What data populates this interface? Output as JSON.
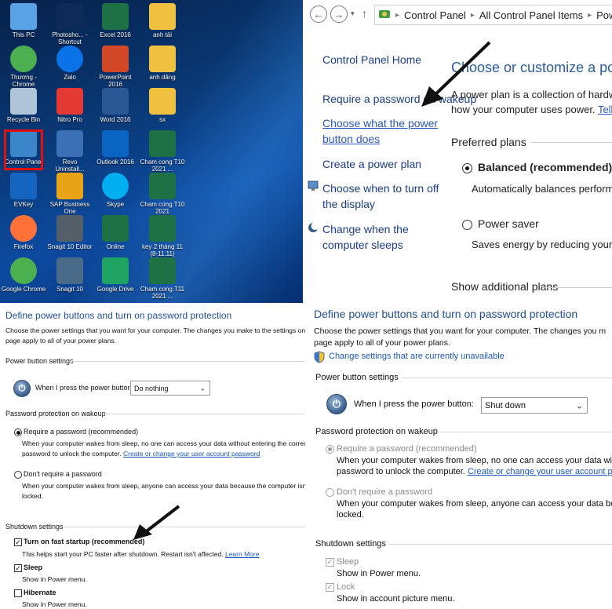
{
  "desktop": {
    "icons": [
      {
        "label": "This PC",
        "icon": "monitor-icon",
        "color": "#5aa2e6"
      },
      {
        "label": "Photosho... - Shortcut",
        "icon": "photoshop-icon",
        "color": "#0d2a58"
      },
      {
        "label": "Excel 2016",
        "icon": "excel-icon",
        "color": "#1e7145"
      },
      {
        "label": "anh tải",
        "icon": "folder-icon",
        "color": "#f0c040"
      },
      {
        "label": "Thương - Chrome",
        "icon": "chrome-icon",
        "color": "#4caf50"
      },
      {
        "label": "Zalo",
        "icon": "zalo-icon",
        "color": "#0a73e8"
      },
      {
        "label": "PowerPoint 2016",
        "icon": "powerpoint-icon",
        "color": "#d24726"
      },
      {
        "label": "anh dăng",
        "icon": "folder-icon",
        "color": "#f0c040"
      },
      {
        "label": "Recycle Bin",
        "icon": "recycle-bin-icon",
        "color": "#b0c4d8"
      },
      {
        "label": "Nitro Pro",
        "icon": "nitro-icon",
        "color": "#e53935"
      },
      {
        "label": "Word 2016",
        "icon": "word-icon",
        "color": "#2b5797"
      },
      {
        "label": "sx",
        "icon": "folder-icon",
        "color": "#f0c040"
      },
      {
        "label": "Control Panel",
        "icon": "control-panel-icon",
        "color": "#3a86c8"
      },
      {
        "label": "Revo Uninstall...",
        "icon": "revo-icon",
        "color": "#3b6fb6"
      },
      {
        "label": "Outlook 2016",
        "icon": "outlook-icon",
        "color": "#0a64c2"
      },
      {
        "label": "Cham cong T10 2021 ...",
        "icon": "excel-file-icon",
        "color": "#1e7145"
      },
      {
        "label": "EVKey",
        "icon": "evkey-icon",
        "color": "#1565c0"
      },
      {
        "label": "SAP Business One",
        "icon": "sap-icon",
        "color": "#e8a317"
      },
      {
        "label": "Skype",
        "icon": "skype-icon",
        "color": "#00aff0"
      },
      {
        "label": "Cham cong T10 2021",
        "icon": "excel-file-icon",
        "color": "#1e7145"
      },
      {
        "label": "Firefox",
        "icon": "firefox-icon",
        "color": "#ff7139"
      },
      {
        "label": "Snagit 10 Editor",
        "icon": "snagit-editor-icon",
        "color": "#555f6a"
      },
      {
        "label": "Online",
        "icon": "excel-file-icon",
        "color": "#1e7145"
      },
      {
        "label": "key 2 tháng 11 (8-11.11)",
        "icon": "excel-file-icon",
        "color": "#1e7145"
      },
      {
        "label": "Google Chrome",
        "icon": "chrome-icon",
        "color": "#4caf50"
      },
      {
        "label": "Snagit 10",
        "icon": "snagit-icon",
        "color": "#4a6a8a"
      },
      {
        "label": "Google Drive",
        "icon": "google-drive-icon",
        "color": "#1fa463"
      },
      {
        "label": "Cham cong T11 2021 ...",
        "icon": "excel-file-icon",
        "color": "#1e7145"
      }
    ]
  },
  "control_panel": {
    "breadcrumb": [
      "Control Panel",
      "All Control Panel Items",
      "Power Options"
    ],
    "sidebar": {
      "home": "Control Panel Home",
      "items": [
        "Require a password on wakeup",
        "Choose what the power button does",
        "Create a power plan",
        "Choose when to turn off the display",
        "Change when the computer sleeps"
      ]
    },
    "title": "Choose or customize a power plan",
    "intro_1": "A power plan is a collection of hardware and s",
    "intro_2": "how your computer uses power.",
    "tell_me_more": "Tell me more",
    "preferred_plans": "Preferred plans",
    "plans": [
      {
        "name": "Balanced (recommended)",
        "desc": "Automatically balances performance wi",
        "selected": true
      },
      {
        "name": "Power saver",
        "desc": "Saves energy by reducing your compute",
        "selected": false
      }
    ],
    "show_additional": "Show additional plans"
  },
  "settings_left": {
    "title": "Define power buttons and turn on password protection",
    "intro_1": "Choose the power settings that you want for your computer. The changes you make to the settings on this",
    "intro_2": "page apply to all of your power plans.",
    "power_button_settings": "Power button settings",
    "press_label": "When I press the power button:",
    "press_value": "Do nothing",
    "password_section": "Password protection on wakeup",
    "require_label": "Require a password (recommended)",
    "require_desc_1": "When your computer wakes from sleep, no one can access your data without entering the correct",
    "require_desc_2": "password to unlock the computer.",
    "create_link": "Create or change your user account password",
    "dont_label": "Don't require a password",
    "dont_desc_1": "When your computer wakes from sleep, anyone can access your data because the computer isn't",
    "dont_desc_2": "locked.",
    "shutdown_section": "Shutdown settings",
    "fast_startup": "Turn on fast startup (recommended)",
    "fast_desc": "This helps start your PC faster after shutdown. Restart isn't affected.",
    "learn_more": "Learn More",
    "sleep": "Sleep",
    "sleep_desc": "Show in Power menu.",
    "hibernate": "Hibernate",
    "hibernate_desc": "Show in Power menu."
  },
  "settings_right": {
    "title": "Define power buttons and turn on password protection",
    "intro_1": "Choose the power settings that you want for your computer. The changes you m",
    "intro_2": "page apply to all of your power plans.",
    "change_unavailable": "Change settings that are currently unavailable",
    "power_button_settings": "Power button settings",
    "press_label": "When I press the power button:",
    "press_value": "Shut down",
    "password_section": "Password protection on wakeup",
    "require_label": "Require a password (recommended)",
    "require_desc_1": "When your computer wakes from sleep, no one can access your data witho",
    "require_desc_2": "password to unlock the computer.",
    "create_link": "Create or change your user account pas",
    "dont_label": "Don't require a password",
    "dont_desc_1": "When your computer wakes from sleep, anyone can access your data beca",
    "dont_desc_2": "locked.",
    "shutdown_section": "Shutdown settings",
    "sleep": "Sleep",
    "sleep_desc": "Show in Power menu.",
    "lock": "Lock",
    "lock_desc": "Show in account picture menu."
  },
  "colors": {
    "accent": "#1f4f9c",
    "link": "#1a56c6",
    "highlight": "#e01010"
  }
}
